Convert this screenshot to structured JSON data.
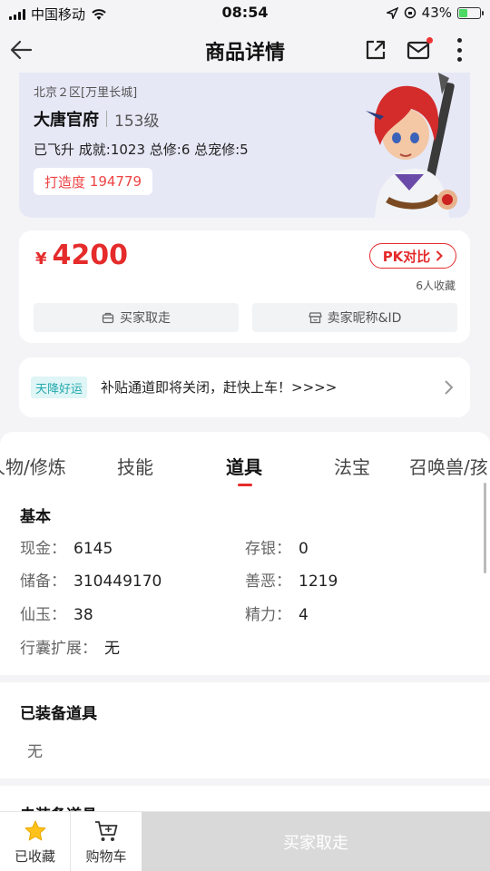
{
  "status_bar": {
    "carrier": "中国移动",
    "time": "08:54",
    "battery": "43%",
    "battery_fraction": 0.43
  },
  "header": {
    "title": "商品详情"
  },
  "character": {
    "server": "北京２区[万里长城]",
    "name": "大唐官府",
    "level": "153级",
    "stats": "已飞升 成就:1023 总修:6 总宠修:5",
    "forge_label": "打造度",
    "forge_value": "194779"
  },
  "price_card": {
    "currency": "¥",
    "price": "4200",
    "pk_label": "PK对比",
    "fav_count": "6人收藏",
    "buyer_pickup_label": "买家取走",
    "seller_id_label": "卖家昵称&ID"
  },
  "notice": {
    "tag": "天降好运",
    "text": "补贴通道即将关闭，赶快上车！>>>>"
  },
  "tabs": [
    "人物/修炼",
    "技能",
    "道具",
    "法宝",
    "召唤兽/孩"
  ],
  "active_tab": "道具",
  "basic": {
    "title": "基本",
    "cash_label": "现金：",
    "cash_value": "6145",
    "savings_label": "存银：",
    "savings_value": "0",
    "reserve_label": "储备：",
    "reserve_value": "310449170",
    "karma_label": "善恶：",
    "karma_value": "1219",
    "jade_label": "仙玉：",
    "jade_value": "38",
    "energy_label": "精力：",
    "energy_value": "4",
    "bag_label": "行囊扩展：",
    "bag_value": "无"
  },
  "equipped": {
    "title": "已装备道具",
    "value": "无"
  },
  "unequipped": {
    "title": "未装备道具"
  },
  "bottom_bar": {
    "fav_label": "已收藏",
    "cart_label": "购物车",
    "buy_label": "买家取走"
  },
  "colors": {
    "accent": "#e52b2b",
    "teal": "#23a9ad",
    "card_bg": "#e6e8f6",
    "star": "#ffc21a"
  }
}
